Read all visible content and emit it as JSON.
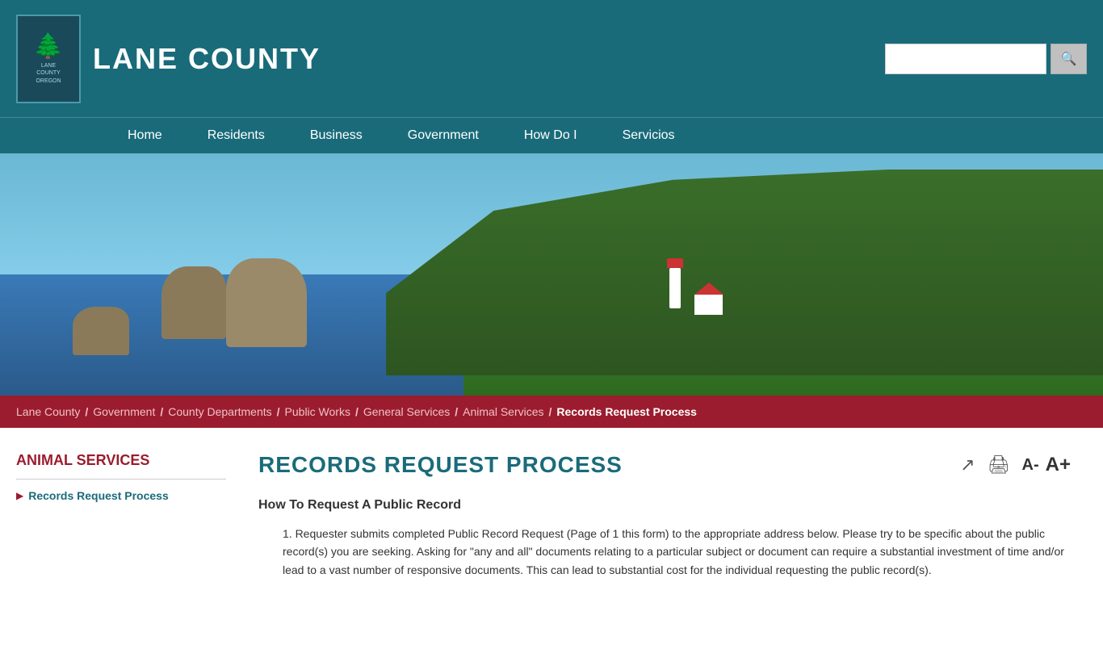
{
  "site": {
    "title": "LANE COUNTY",
    "logo_lines": [
      "LANE",
      "COUNTY",
      "OREGON"
    ]
  },
  "nav": {
    "items": [
      "Home",
      "Residents",
      "Business",
      "Government",
      "How Do I",
      "Servicios"
    ]
  },
  "search": {
    "placeholder": "",
    "button_icon": "🔍"
  },
  "breadcrumb": {
    "items": [
      {
        "label": "Lane County",
        "href": "#"
      },
      {
        "label": "Government",
        "href": "#"
      },
      {
        "label": "County Departments",
        "href": "#"
      },
      {
        "label": "Public Works",
        "href": "#"
      },
      {
        "label": "General Services",
        "href": "#"
      },
      {
        "label": "Animal Services",
        "href": "#"
      }
    ],
    "current": "Records Request Process"
  },
  "sidebar": {
    "section_title": "ANIMAL SERVICES",
    "links": [
      {
        "label": "Records Request Process"
      }
    ]
  },
  "main": {
    "page_title": "RECORDS REQUEST PROCESS",
    "tools": {
      "share_label": "↗",
      "print_label": "🖨",
      "font_dec": "A-",
      "font_inc": "A+"
    },
    "section_heading": "How To Request A Public Record",
    "content_p1": "1. Requester submits completed Public Record Request (Page of 1 this form) to the appropriate address below. Please try to be specific about the public record(s) you are seeking. Asking for \"any and all\" documents relating to a particular subject or document can require a substantial investment of time and/or lead to a vast number of responsive documents. This can lead to substantial cost for the individual requesting the public record(s)."
  }
}
